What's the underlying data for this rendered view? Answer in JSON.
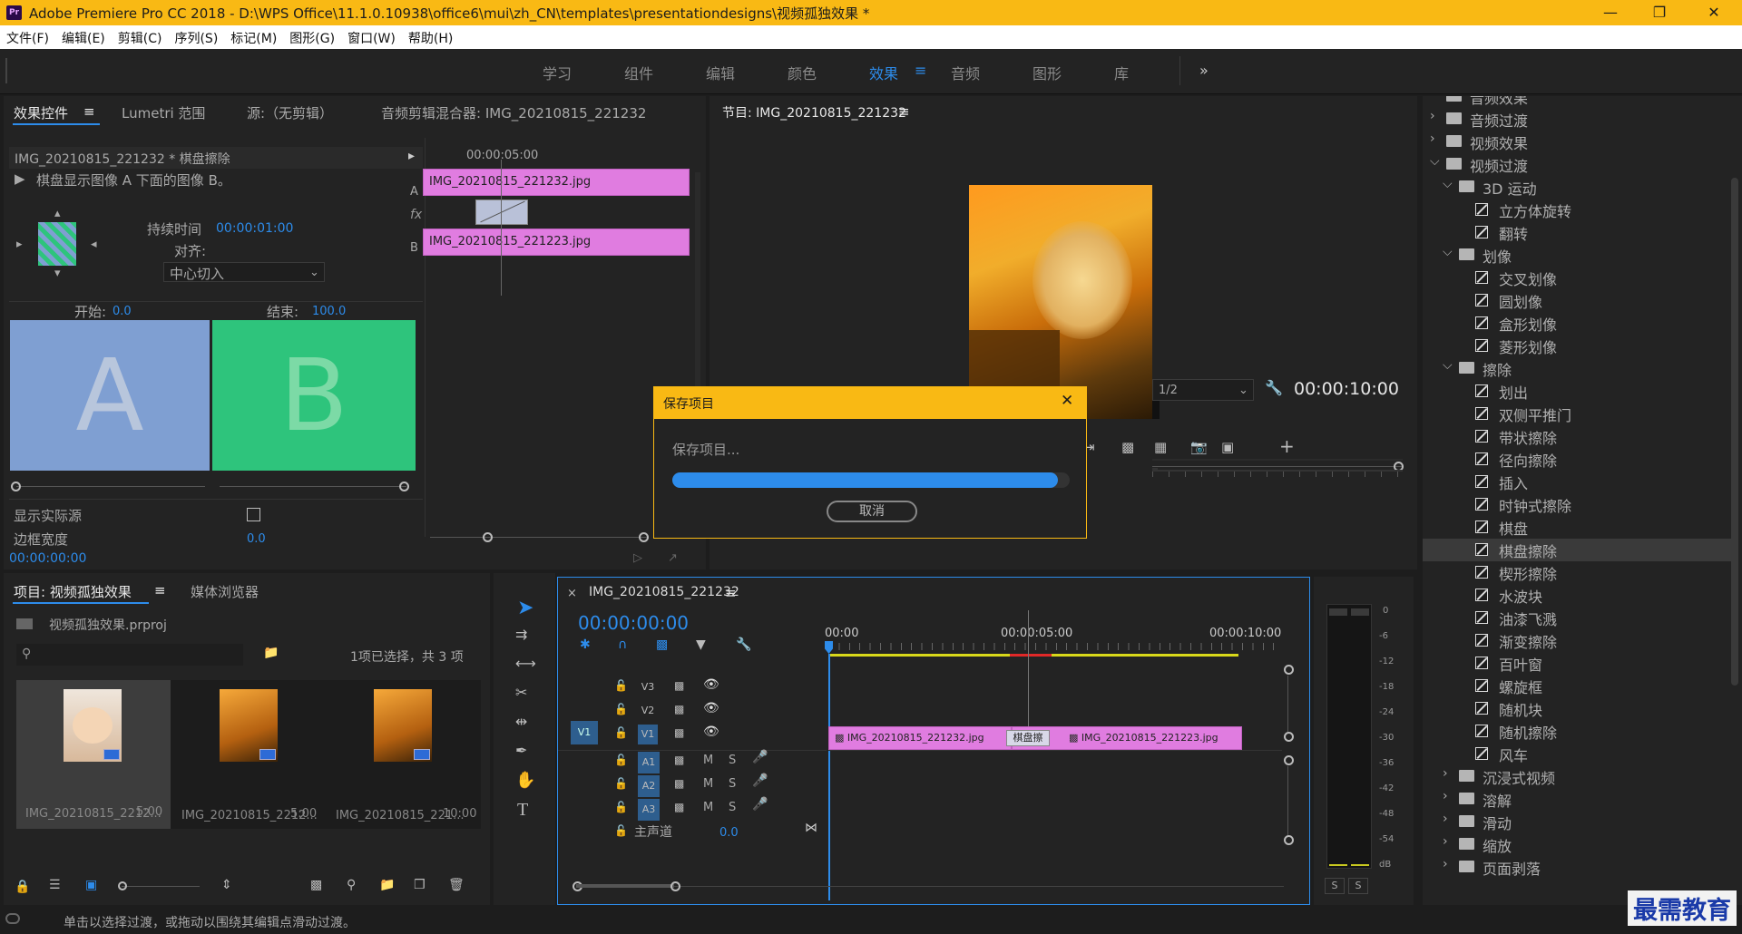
{
  "window": {
    "title": "Adobe Premiere Pro CC 2018 - D:\\WPS Office\\11.1.0.10938\\office6\\mui\\zh_CN\\templates\\presentationdesigns\\视频孤独效果 *",
    "app_icon": "Pr"
  },
  "menu": [
    "文件(F)",
    "编辑(E)",
    "剪辑(C)",
    "序列(S)",
    "标记(M)",
    "图形(G)",
    "窗口(W)",
    "帮助(H)"
  ],
  "workspaces": [
    "学习",
    "组件",
    "编辑",
    "颜色",
    "效果",
    "音频",
    "图形",
    "库"
  ],
  "workspaces_active": "效果",
  "effect_controls": {
    "tabs": [
      "效果控件",
      "Lumetri 范围",
      "源:（无剪辑）",
      "音频剪辑混合器: IMG_20210815_221232"
    ],
    "clip_header": "IMG_20210815_221232 * 棋盘擦除",
    "description": "棋盘显示图像 A 下面的图像 B。",
    "duration_label": "持续时间",
    "duration_value": "00:00:01:00",
    "align_label": "对齐:",
    "align_value": "中心切入",
    "start_label": "开始:",
    "start_value": "0.0",
    "end_label": "结束:",
    "end_value": "100.0",
    "preview_a": "A",
    "preview_b": "B",
    "show_actual_label": "显示实际源",
    "border_width_label": "边框宽度",
    "border_width_value": "0.0",
    "timecode": "00:00:00:00",
    "mini_timecode": "00:00:05:00",
    "clip_a": "IMG_20210815_221232.jpg",
    "clip_b": "IMG_20210815_221223.jpg",
    "track_a": "A",
    "track_b": "B",
    "fx": "fx"
  },
  "program": {
    "title": "节目: IMG_20210815_221232",
    "zoom": "1/2",
    "timecode": "00:00:10:00"
  },
  "dialog": {
    "title": "保存项目",
    "message": "保存项目...",
    "cancel": "取消",
    "progress": 0.97
  },
  "project": {
    "tabs": [
      "项目: 视频孤独效果",
      "媒体浏览器"
    ],
    "file": "视频孤独效果.prproj",
    "selection": "1项已选择，共 3 项",
    "items": [
      {
        "name": "IMG_20210815_2212...",
        "dur": "5:00"
      },
      {
        "name": "IMG_20210815_2212...",
        "dur": "5:00"
      },
      {
        "name": "IMG_20210815_221...",
        "dur": "10:00"
      }
    ]
  },
  "timeline": {
    "title": "IMG_20210815_221232",
    "timecode": "00:00:00:00",
    "ruler": [
      "00:00",
      "00:00:05:00",
      "00:00:10:00"
    ],
    "video_tracks": [
      "V3",
      "V2",
      "V1"
    ],
    "audio_tracks": [
      "A1",
      "A2",
      "A3"
    ],
    "source_v1": "V1",
    "master": "主声道",
    "master_value": "0.0",
    "clip1": "IMG_20210815_221232.jpg",
    "clip2": "IMG_20210815_221223.jpg",
    "transition": "棋盘擦",
    "m": "M",
    "s": "S"
  },
  "meter": {
    "labels": [
      "0",
      "-6",
      "-12",
      "-18",
      "-24",
      "-30",
      "-36",
      "-42",
      "-48",
      "-54",
      "dB"
    ],
    "solo": [
      "S",
      "S"
    ]
  },
  "effects_tree": [
    {
      "t": "folder",
      "lvl": 0,
      "open": false,
      "label": "音频效果"
    },
    {
      "t": "folder",
      "lvl": 0,
      "open": false,
      "label": "音频过渡"
    },
    {
      "t": "folder",
      "lvl": 0,
      "open": false,
      "label": "视频效果"
    },
    {
      "t": "folder",
      "lvl": 0,
      "open": true,
      "label": "视频过渡"
    },
    {
      "t": "folder",
      "lvl": 1,
      "open": true,
      "label": "3D 运动"
    },
    {
      "t": "fx",
      "label": "立方体旋转"
    },
    {
      "t": "fx",
      "label": "翻转"
    },
    {
      "t": "folder",
      "lvl": 1,
      "open": true,
      "label": "划像"
    },
    {
      "t": "fx",
      "label": "交叉划像"
    },
    {
      "t": "fx",
      "label": "圆划像"
    },
    {
      "t": "fx",
      "label": "盒形划像"
    },
    {
      "t": "fx",
      "label": "菱形划像"
    },
    {
      "t": "folder",
      "lvl": 1,
      "open": true,
      "label": "擦除"
    },
    {
      "t": "fx",
      "label": "划出"
    },
    {
      "t": "fx",
      "label": "双侧平推门"
    },
    {
      "t": "fx",
      "label": "带状擦除"
    },
    {
      "t": "fx",
      "label": "径向擦除"
    },
    {
      "t": "fx",
      "label": "插入"
    },
    {
      "t": "fx",
      "label": "时钟式擦除"
    },
    {
      "t": "fx",
      "label": "棋盘"
    },
    {
      "t": "fx",
      "label": "棋盘擦除",
      "selected": true
    },
    {
      "t": "fx",
      "label": "楔形擦除"
    },
    {
      "t": "fx",
      "label": "水波块"
    },
    {
      "t": "fx",
      "label": "油漆飞溅"
    },
    {
      "t": "fx",
      "label": "渐变擦除"
    },
    {
      "t": "fx",
      "label": "百叶窗"
    },
    {
      "t": "fx",
      "label": "螺旋框"
    },
    {
      "t": "fx",
      "label": "随机块"
    },
    {
      "t": "fx",
      "label": "随机擦除"
    },
    {
      "t": "fx",
      "label": "风车"
    },
    {
      "t": "folder",
      "lvl": 1,
      "open": false,
      "label": "沉浸式视频"
    },
    {
      "t": "folder",
      "lvl": 1,
      "open": false,
      "label": "溶解"
    },
    {
      "t": "folder",
      "lvl": 1,
      "open": false,
      "label": "滑动"
    },
    {
      "t": "folder",
      "lvl": 1,
      "open": false,
      "label": "缩放"
    },
    {
      "t": "folder",
      "lvl": 1,
      "open": false,
      "label": "页面剥落"
    }
  ],
  "status": "单击以选择过渡，或拖动以围绕其编辑点滑动过渡。",
  "watermark": "最需教育",
  "colors": {
    "accent": "#2d8ceb",
    "titlebar": "#f9b914",
    "clip": "#e07ce0",
    "a_box": "#7f9fd2",
    "b_box": "#2ec47c"
  }
}
